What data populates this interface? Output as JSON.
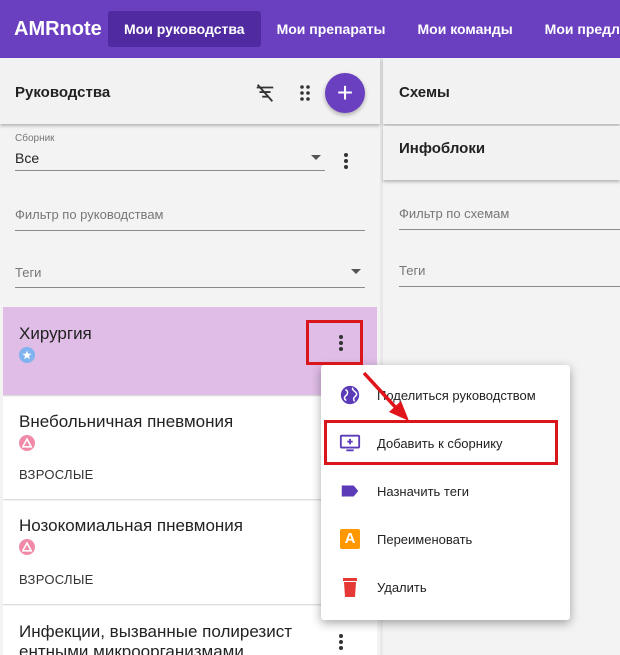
{
  "app": {
    "brand": "AMRnote",
    "nav": [
      "Мои руководства",
      "Мои препараты",
      "Мои команды",
      "Мои предложения"
    ],
    "nav_active": 0
  },
  "left_panel": {
    "title": "Руководства",
    "collection_label": "Сборник",
    "collection_value": "Все",
    "filter_placeholder": "Фильтр по руководствам",
    "tags_placeholder": "Теги",
    "add_symbol": "+"
  },
  "right_panel": {
    "title": "Схемы",
    "infoblocks_title": "Инфоблоки",
    "filter_placeholder": "Фильтр по схемам",
    "tags_placeholder": "Теги"
  },
  "guides": [
    {
      "title": "Хирургия",
      "badge_icon": "star-icon",
      "tag": ""
    },
    {
      "title": "Внебольничная пневмония",
      "badge_icon": "triangle-icon",
      "tag": "ВЗРОСЛЫЕ"
    },
    {
      "title": "Нозокомиальная пневмония",
      "badge_icon": "triangle-icon",
      "tag": "ВЗРОСЛЫЕ"
    },
    {
      "title_line1": "Инфекции, вызванные полирезист",
      "title_line2": "ентными микроорганизмами"
    }
  ],
  "context_menu": {
    "items": [
      {
        "label": "Поделиться руководством",
        "icon": "globe-icon"
      },
      {
        "label": "Добавить к сборнику",
        "icon": "add-to-collection-icon"
      },
      {
        "label": "Назначить теги",
        "icon": "label-icon"
      },
      {
        "label": "Переименовать",
        "icon": "rename-icon",
        "glyph": "A"
      },
      {
        "label": "Удалить",
        "icon": "trash-icon"
      }
    ]
  },
  "colors": {
    "brand": "#6a3fc0",
    "selected_card": "#dfbde6",
    "highlight": "#d9161c",
    "badge_star": "#7fb2ee",
    "badge_triangle": "#f08aa8",
    "rename_icon": "#ff9800",
    "trash_icon": "#e53935"
  }
}
